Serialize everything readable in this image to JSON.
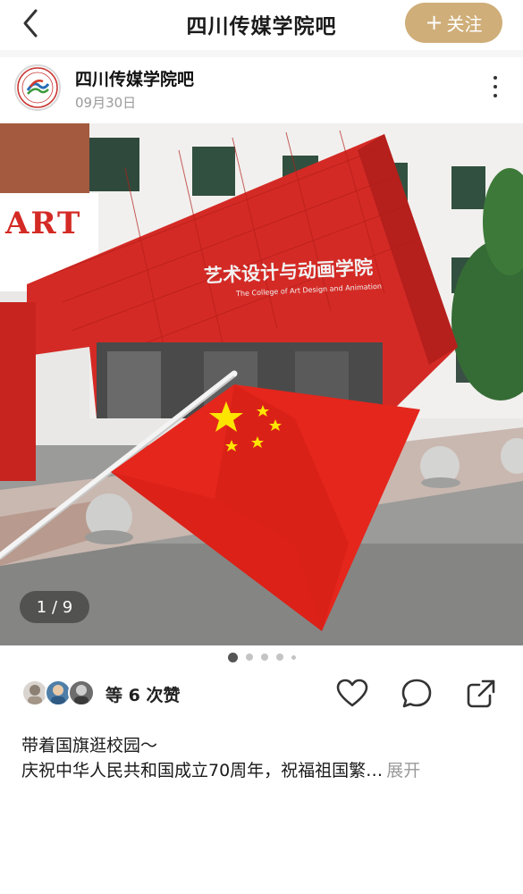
{
  "navbar": {
    "title": "四川传媒学院吧",
    "follow_label": "关注",
    "follow_plus": "+",
    "back_icon": "chevron-left-icon"
  },
  "post": {
    "author": "四川传媒学院吧",
    "date": "09月30日",
    "photo": {
      "sign_text": "艺术设计与动画学院",
      "sign_subtext": "The College of Art Design and Animation",
      "side_logo": "ART",
      "counter": "1 / 9"
    },
    "carousel": {
      "total": 5,
      "active_index": 0
    },
    "likes_text": "等 6 次赞",
    "caption_line1": "带着国旗逛校园～",
    "caption_line2": "庆祝中华人民共和国成立70周年，祝福祖国繁…",
    "expand_label": "展开"
  },
  "colors": {
    "accent": "#cfae79",
    "building_red": "#d42a25",
    "flag_red": "#e5261c",
    "star_yellow": "#fde500"
  }
}
